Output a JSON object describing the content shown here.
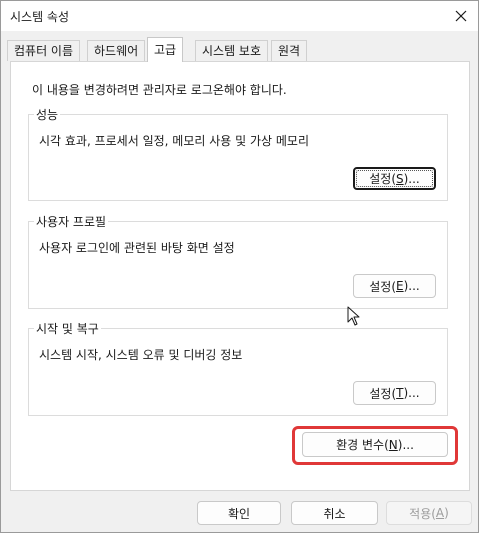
{
  "window": {
    "title": "시스템 속성"
  },
  "tabs": [
    {
      "label": "컴퓨터 이름"
    },
    {
      "label": "하드웨어"
    },
    {
      "label": "고급"
    },
    {
      "label": "시스템 보호"
    },
    {
      "label": "원격"
    }
  ],
  "advanced": {
    "notice": "이 내용을 변경하려면 관리자로 로그온해야 합니다.",
    "performance": {
      "legend": "성능",
      "description": "시각 효과, 프로세서 일정, 메모리 사용 및 가상 메모리",
      "button": {
        "label_pre": "설정(",
        "accel": "S",
        "label_post": ")..."
      }
    },
    "user_profiles": {
      "legend": "사용자 프로필",
      "description": "사용자 로그인에 관련된 바탕 화면 설정",
      "button": {
        "label_pre": "설정(",
        "accel": "E",
        "label_post": ")..."
      }
    },
    "startup_recovery": {
      "legend": "시작 및 복구",
      "description": "시스템 시작, 시스템 오류 및 디버깅 정보",
      "button": {
        "label_pre": "설정(",
        "accel": "T",
        "label_post": ")..."
      }
    },
    "env_vars_button": {
      "label_pre": "환경 변수(",
      "accel": "N",
      "label_post": ")..."
    }
  },
  "footer": {
    "ok": "확인",
    "cancel": "취소",
    "apply": {
      "label_pre": "적용(",
      "accel": "A",
      "label_post": ")"
    }
  },
  "colors": {
    "highlight": "#e03838"
  },
  "icons": {
    "close": "close-icon",
    "cursor": "mouse-pointer-icon"
  }
}
